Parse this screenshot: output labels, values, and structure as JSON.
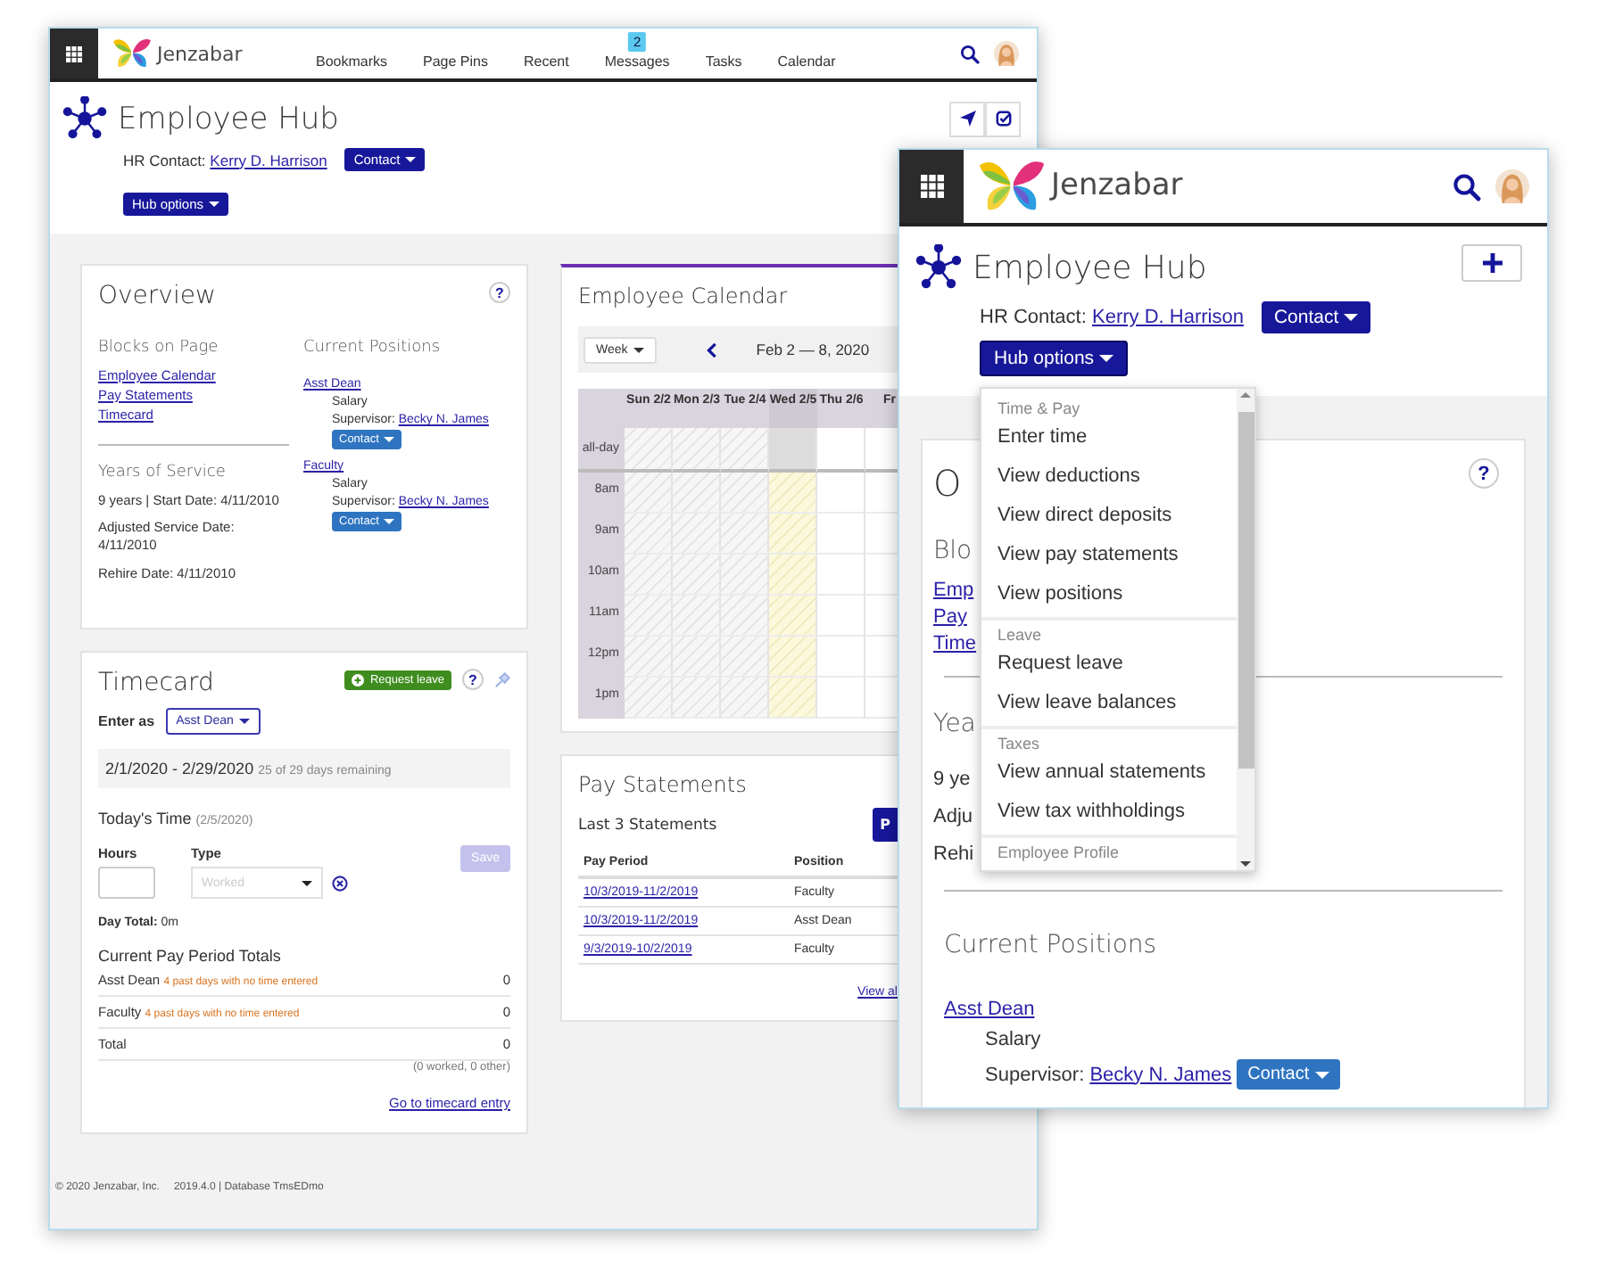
{
  "back_window": {
    "header": {
      "logo_text": "Jenzabar",
      "nav": [
        {
          "label": "Bookmarks"
        },
        {
          "label": "Page Pins"
        },
        {
          "label": "Recent"
        },
        {
          "label": "Messages",
          "badge": "2"
        },
        {
          "label": "Tasks"
        },
        {
          "label": "Calendar"
        }
      ]
    },
    "page": {
      "title": "Employee Hub",
      "hr_contact_label": "HR Contact:",
      "hr_contact_name": "Kerry D. Harrison",
      "contact_button": "Contact",
      "hub_options_button": "Hub options"
    },
    "overview": {
      "title": "Overview",
      "help": "?",
      "blocks_heading": "Blocks on Page",
      "blocks": [
        "Employee Calendar",
        "Pay Statements",
        "Timecard"
      ],
      "service_heading": "Years of Service",
      "service_lines": [
        "9 years | Start Date: 4/11/2010",
        "Adjusted Service Date: 4/11/2010",
        "Rehire Date: 4/11/2010"
      ],
      "positions_heading": "Current Positions",
      "positions": [
        {
          "title": "Asst Dean",
          "pay_type": "Salary",
          "supervisor_label": "Supervisor:",
          "supervisor": "Becky N. James",
          "contact_button": "Contact"
        },
        {
          "title": "Faculty",
          "pay_type": "Salary",
          "supervisor_label": "Supervisor:",
          "supervisor": "Becky N. James",
          "contact_button": "Contact"
        }
      ]
    },
    "timecard": {
      "title": "Timecard",
      "request_leave": "Request leave",
      "help": "?",
      "enter_as_label": "Enter as",
      "enter_as_value": "Asst Dean",
      "period": "2/1/2020 - 2/29/2020",
      "period_note": "25 of 29 days remaining",
      "today_label": "Today's Time",
      "today_date": "(2/5/2020)",
      "hours_label": "Hours",
      "type_label": "Type",
      "type_placeholder": "Worked",
      "save_button": {
        "label": "Save",
        "disabled": true
      },
      "day_total": "**Day Total:** 0m",
      "totals_heading": "Current Pay Period Totals",
      "totals": [
        {
          "label": "Asst Dean",
          "warning": "4 past days with no time entered",
          "value": "0"
        },
        {
          "label": "Faculty",
          "warning": "4 past days with no time entered",
          "value": "0"
        },
        {
          "label": "Total",
          "value": "0"
        }
      ],
      "totals_note": "(0 worked, 0 other)",
      "entry_link": "Go to timecard entry"
    },
    "calendar": {
      "title": "Employee Calendar",
      "view_select": "Week",
      "range": "Feb 2 — 8, 2020",
      "days": [
        {
          "label": "Sun 2/2",
          "kind": "past"
        },
        {
          "label": "Mon 2/3",
          "kind": "past"
        },
        {
          "label": "Tue 2/4",
          "kind": "past"
        },
        {
          "label": "Wed 2/5",
          "kind": "today"
        },
        {
          "label": "Thu 2/6",
          "kind": "future"
        },
        {
          "label": "Fr",
          "kind": "future"
        }
      ],
      "times": [
        "all-day",
        "8am",
        "9am",
        "10am",
        "11am",
        "12pm",
        "1pm"
      ]
    },
    "pay_statements": {
      "title": "Pay Statements",
      "subtitle": "Last 3 Statements",
      "button": "P",
      "columns": [
        "Pay Period",
        "Position"
      ],
      "rows": [
        {
          "period": "10/3/2019-11/2/2019",
          "position": "Faculty"
        },
        {
          "period": "10/3/2019-11/2/2019",
          "position": "Asst Dean"
        },
        {
          "period": "9/3/2019-10/2/2019",
          "position": "Faculty"
        }
      ],
      "view_all": "View al"
    },
    "footer": {
      "copyright": "© 2020 Jenzabar, Inc.",
      "version": "2019.4.0 | Database TmsEDmo"
    }
  },
  "front_window": {
    "header": {
      "logo_text": "Jenzabar"
    },
    "page": {
      "title": "Employee Hub",
      "hr_contact_label": "HR Contact:",
      "hr_contact_name": "Kerry D. Harrison",
      "contact_button": "Contact",
      "hub_options": {
        "label": "Hub options",
        "expanded": true
      }
    },
    "hub_menu": {
      "groups": [
        {
          "label": "Time & Pay",
          "items": [
            "Enter time",
            "View deductions",
            "View direct deposits",
            "View pay statements",
            "View positions"
          ]
        },
        {
          "label": "Leave",
          "items": [
            "Request leave",
            "View leave balances"
          ]
        },
        {
          "label": "Taxes",
          "items": [
            "View annual statements",
            "View tax withholdings"
          ]
        },
        {
          "label": "Employee Profile"
        }
      ]
    },
    "overview": {
      "title": "O",
      "help": "?",
      "blocks_heading": "Blo",
      "blocks": [
        "Emp",
        "Pay",
        "Time"
      ],
      "service_heading": "Yea",
      "service_lines": [
        "9 ye",
        "Adju",
        "Rehi"
      ],
      "positions_heading": "Current Positions",
      "positions": [
        {
          "title": "Asst Dean",
          "pay_type": "Salary",
          "supervisor_label": "Supervisor:",
          "supervisor": "Becky N. James",
          "contact_button": "Contact"
        }
      ]
    }
  }
}
